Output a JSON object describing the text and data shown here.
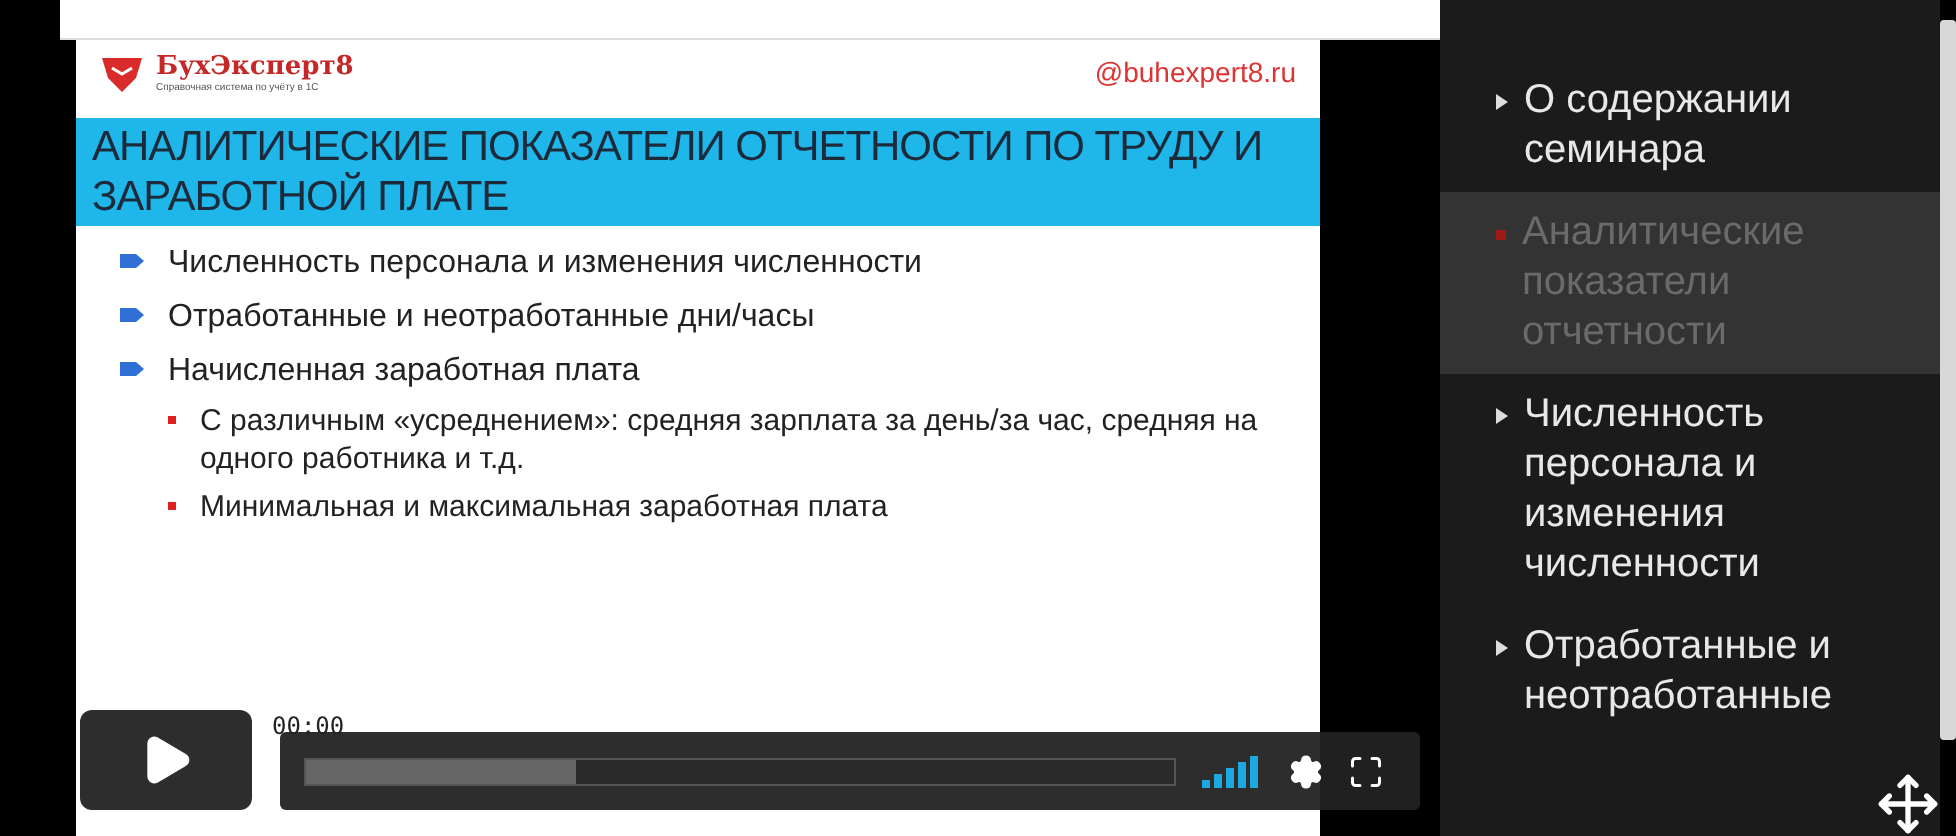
{
  "slide": {
    "brand": "БухЭксперт8",
    "tagline": "Справочная система по учёту в 1С",
    "handle": "@buhexpert8.ru",
    "title": "АНАЛИТИЧЕСКИЕ ПОКАЗАТЕЛИ ОТЧЕТНОСТИ ПО ТРУДУ И ЗАРАБОТНОЙ ПЛАТЕ",
    "bullets": [
      {
        "text": "Численность персонала и изменения численности"
      },
      {
        "text": "Отработанные и неотработанные дни/часы"
      },
      {
        "text": "Начисленная заработная плата",
        "children": [
          {
            "text": "С различным «усреднением»: средняя зарплата за день/за час, средняя на одного работника и т.д."
          },
          {
            "text": "Минимальная и максимальная заработная плата"
          }
        ]
      }
    ]
  },
  "player": {
    "time": "00:00",
    "buffered": {
      "level": 0.31
    }
  },
  "chapters": [
    {
      "label": "О содержании семинара",
      "selected": false
    },
    {
      "label": "Аналитические показатели отчетности",
      "selected": true
    },
    {
      "label": "Численность персонала и изменения численности",
      "selected": false
    },
    {
      "label": "Отработанные и неотработанные",
      "selected": false
    }
  ]
}
